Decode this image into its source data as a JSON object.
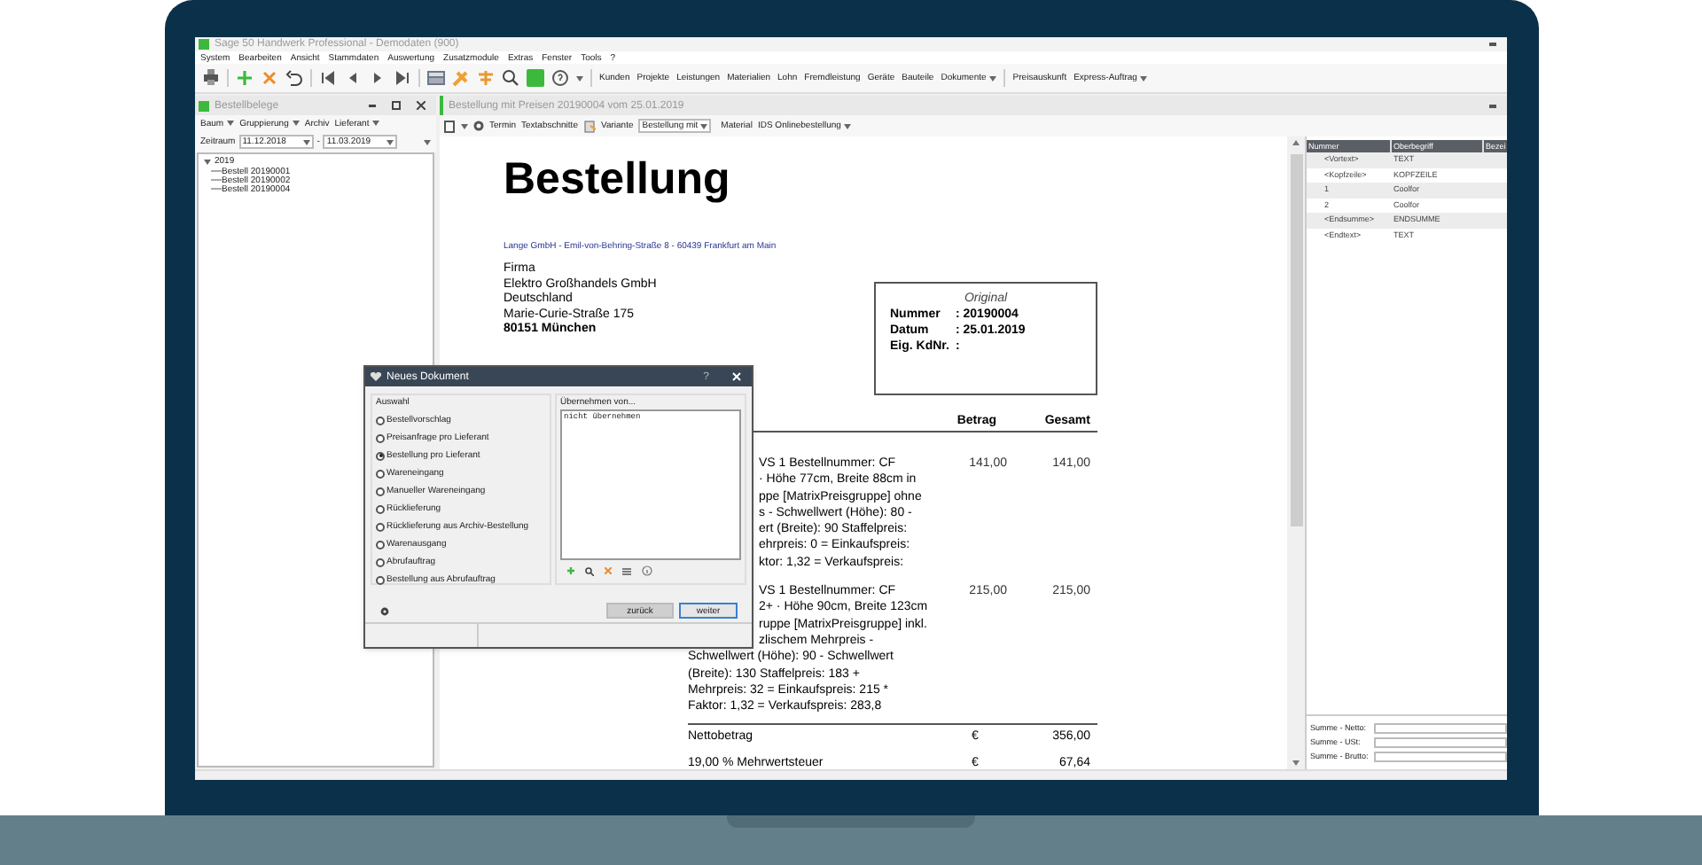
{
  "window": {
    "title": "Sage 50 Handwerk Professional - Demodaten (900)"
  },
  "menu": [
    "System",
    "Bearbeiten",
    "Ansicht",
    "Stammdaten",
    "Auswertung",
    "Zusatzmodule",
    "Extras",
    "Fenster",
    "Tools",
    "?"
  ],
  "toolbar": {
    "modules": [
      {
        "label": "Kunden",
        "dropdown": false
      },
      {
        "label": "Projekte",
        "dropdown": false
      },
      {
        "label": "Leistungen",
        "dropdown": false
      },
      {
        "label": "Materialien",
        "dropdown": false
      },
      {
        "label": "Lohn",
        "dropdown": false
      },
      {
        "label": "Fremdleistung",
        "dropdown": false
      },
      {
        "label": "Geräte",
        "dropdown": false
      },
      {
        "label": "Bauteile",
        "dropdown": false
      },
      {
        "label": "Dokumente",
        "dropdown": true
      }
    ],
    "extras": [
      {
        "label": "Preisauskunft",
        "dropdown": false
      },
      {
        "label": "Express-Auftrag",
        "dropdown": true
      }
    ]
  },
  "left_panel": {
    "title": "Bestellbelege",
    "filters": [
      {
        "label": "Baum",
        "dropdown": true
      },
      {
        "label": "Gruppierung",
        "dropdown": true
      },
      {
        "label": "Archiv",
        "dropdown": false
      },
      {
        "label": "Lieferant",
        "dropdown": true
      }
    ],
    "period": {
      "label": "Zeitraum",
      "from": "11.12.2018",
      "separator": "-",
      "to": "11.03.2019"
    },
    "tree": [
      {
        "label": "2019",
        "expanded": true,
        "children": [
          {
            "label": "Bestell 20190001"
          },
          {
            "label": "Bestell 20190002"
          },
          {
            "label": "Bestell 20190004"
          }
        ]
      }
    ]
  },
  "document_tab": {
    "title": "Bestellung mit Preisen 20190004 vom 25.01.2019"
  },
  "doc_toolbar": {
    "termin": "Termin",
    "textabschnitte": "Textabschnitte",
    "variante": "Variante",
    "variant_value": "Bestellung mit",
    "material": "Material",
    "material_value": "IDS Onlinebestellung"
  },
  "document": {
    "heading": "Bestellung",
    "sender": "Lange GmbH - Emil-von-Behring-Straße 8 - 60439 Frankfurt am Main",
    "address": [
      {
        "text": "Firma",
        "bold": false
      },
      {
        "text": "Elektro Großhandels GmbH",
        "bold": false
      },
      {
        "text": "Deutschland",
        "bold": false
      },
      {
        "text": "Marie-Curie-Straße 175",
        "bold": false
      },
      {
        "text": "80151 München",
        "bold": true
      }
    ],
    "info_box": {
      "caption": "Original",
      "rows": [
        {
          "label": "Nummer",
          "value": ": 20190004"
        },
        {
          "label": "Datum",
          "value": ": 25.01.2019"
        },
        {
          "label": "Eig. KdNr.",
          "value": ":"
        }
      ]
    },
    "columns": [
      "Betrag",
      "Gesamt"
    ],
    "items": [
      {
        "betrag": "141,00",
        "gesamt": "141,00",
        "lines": [
          {
            "text": "VS 1   Bestellnummer:  CF",
            "kind": "clipped"
          },
          {
            "text": "· Höhe 77cm, Breite 88cm in",
            "kind": "clipped"
          },
          {
            "text": "ppe [MatrixPreisgruppe] ohne",
            "kind": "clipped"
          },
          {
            "text": "s  - Schwellwert (Höhe): 80  -",
            "kind": "clipped"
          },
          {
            "text": "ert (Breite): 90     Staffelpreis:",
            "kind": "clipped"
          },
          {
            "text": "ehrpreis:  0  = Einkaufspreis:",
            "kind": "clipped"
          },
          {
            "text": "ktor:  1,32  =  Verkaufspreis:",
            "kind": "clipped"
          }
        ]
      },
      {
        "betrag": "215,00",
        "gesamt": "215,00",
        "lines": [
          {
            "text": "VS 1   Bestellnummer:  CF",
            "kind": "clipped"
          },
          {
            "text": "2+   · Höhe 90cm, Breite 123cm",
            "kind": "clipped"
          },
          {
            "text": "ruppe [MatrixPreisgruppe] inkl.",
            "kind": "clipped"
          },
          {
            "text": "zlischem Mehrpreis  -",
            "kind": "clipped"
          },
          {
            "text": "Schwellwert (Höhe): 90  - Schwellwert",
            "kind": "full"
          },
          {
            "text": "(Breite): 130     Staffelpreis:  183  +",
            "kind": "full"
          },
          {
            "text": "Mehrpreis:  32  = Einkaufspreis:  215  *",
            "kind": "full"
          },
          {
            "text": "Faktor:  1,32  =  Verkaufspreis:  283,8",
            "kind": "full"
          }
        ]
      }
    ],
    "totals": [
      {
        "label": "Nettobetrag",
        "currency": "€",
        "amount": "356,00"
      },
      {
        "label": "19,00 % Mehrwertsteuer",
        "currency": "€",
        "amount": "67,64"
      }
    ]
  },
  "structure_panel": {
    "columns": [
      "Nummer",
      "Oberbegriff",
      "Bezei"
    ],
    "rows": [
      {
        "nummer": "<Vortext>",
        "oberbegriff": "TEXT"
      },
      {
        "nummer": "<Kopfzeile>",
        "oberbegriff": "KOPFZEILE"
      },
      {
        "nummer": "1",
        "oberbegriff": "Coolfor"
      },
      {
        "nummer": "2",
        "oberbegriff": "Coolfor"
      },
      {
        "nummer": "<Endsumme>",
        "oberbegriff": "ENDSUMME"
      },
      {
        "nummer": "<Endtext>",
        "oberbegriff": "TEXT"
      }
    ],
    "sums": [
      "Summe - Netto:",
      "Summe - USt:",
      "Summe - Brutto:"
    ]
  },
  "dialog": {
    "title": "Neues Dokument",
    "help": "?",
    "left_group": "Auswahl",
    "options": [
      {
        "label": "Bestellvorschlag",
        "selected": false
      },
      {
        "label": "Preisanfrage pro Lieferant",
        "selected": false
      },
      {
        "label": "Bestellung pro Lieferant",
        "selected": true
      },
      {
        "label": "Wareneingang",
        "selected": false
      },
      {
        "label": "Manueller Wareneingang",
        "selected": false
      },
      {
        "label": "Rücklieferung",
        "selected": false
      },
      {
        "label": "Rücklieferung aus Archiv-Bestellung",
        "selected": false
      },
      {
        "label": "Warenausgang",
        "selected": false
      },
      {
        "label": "Abrufauftrag",
        "selected": false
      },
      {
        "label": "Bestellung aus Abrufauftrag",
        "selected": false
      }
    ],
    "right_group": "Übernehmen von...",
    "list": [
      "nicht übernehmen"
    ],
    "buttons": [
      {
        "label": "zurück",
        "kind": "secondary"
      },
      {
        "label": "weiter",
        "kind": "primary"
      }
    ]
  }
}
